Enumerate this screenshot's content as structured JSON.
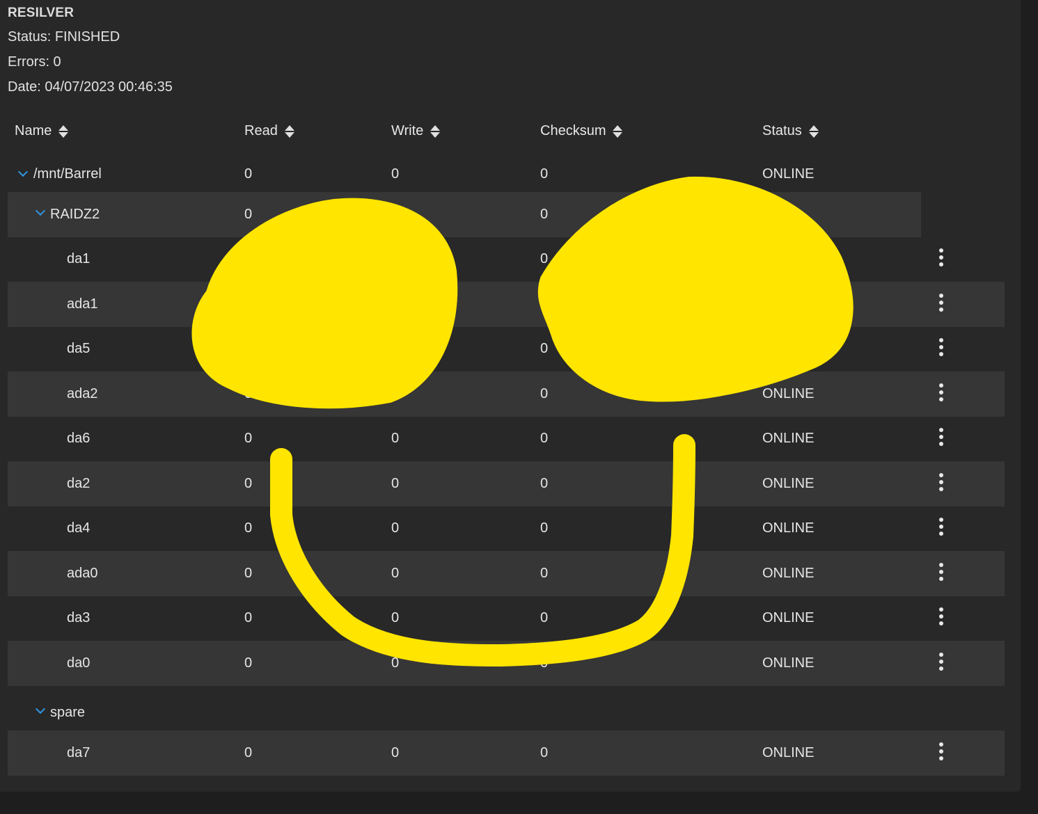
{
  "scan": {
    "title": "RESILVER",
    "status": "Status: FINISHED",
    "errors": "Errors: 0",
    "date": "Date: 04/07/2023 00:46:35"
  },
  "columns": {
    "name": "Name",
    "read": "Read",
    "write": "Write",
    "checksum": "Checksum",
    "status": "Status"
  },
  "rows": [
    {
      "name": "/mnt/Barrel",
      "read": "0",
      "write": "0",
      "checksum": "0",
      "status": "ONLINE"
    },
    {
      "name": "RAIDZ2",
      "read": "0",
      "write": "",
      "checksum": "0",
      "status": ""
    },
    {
      "name": "da1",
      "read": "",
      "write": "",
      "checksum": "0",
      "status": ""
    },
    {
      "name": "ada1",
      "read": "",
      "write": "",
      "checksum": "0",
      "status": ""
    },
    {
      "name": "da5",
      "read": "",
      "write": "",
      "checksum": "0",
      "status": ""
    },
    {
      "name": "ada2",
      "read": "0",
      "write": "0",
      "checksum": "0",
      "status": "ONLINE"
    },
    {
      "name": "da6",
      "read": "0",
      "write": "0",
      "checksum": "0",
      "status": "ONLINE"
    },
    {
      "name": "da2",
      "read": "0",
      "write": "0",
      "checksum": "0",
      "status": "ONLINE"
    },
    {
      "name": "da4",
      "read": "0",
      "write": "0",
      "checksum": "0",
      "status": "ONLINE"
    },
    {
      "name": "ada0",
      "read": "0",
      "write": "0",
      "checksum": "0",
      "status": "ONLINE"
    },
    {
      "name": "da3",
      "read": "0",
      "write": "0",
      "checksum": "0",
      "status": "ONLINE"
    },
    {
      "name": "da0",
      "read": "0",
      "write": "0",
      "checksum": "0",
      "status": "ONLINE"
    },
    {
      "name": "spare",
      "read": "",
      "write": "",
      "checksum": "",
      "status": ""
    },
    {
      "name": "da7",
      "read": "0",
      "write": "0",
      "checksum": "0",
      "status": "ONLINE"
    }
  ],
  "colors": {
    "background": "#1e1e1e",
    "panel": "#282828",
    "row_shade": "#363636",
    "accent": "#2f97e0",
    "drawing": "#ffe500"
  },
  "icons": {
    "sort": "sort-icon",
    "expand": "chevron-down-icon",
    "menu": "more-vert-icon"
  }
}
